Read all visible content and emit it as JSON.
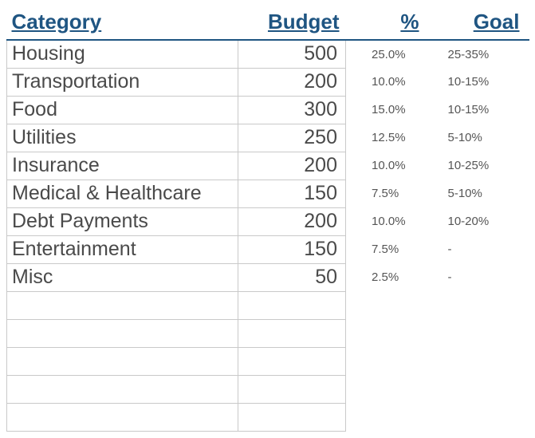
{
  "headers": {
    "category": "Category",
    "budget": "Budget",
    "percent": "%",
    "goal": "Goal"
  },
  "rows": [
    {
      "category": "Housing",
      "budget": "500",
      "percent": "25.0%",
      "goal": "25-35%"
    },
    {
      "category": "Transportation",
      "budget": "200",
      "percent": "10.0%",
      "goal": "10-15%"
    },
    {
      "category": "Food",
      "budget": "300",
      "percent": "15.0%",
      "goal": "10-15%"
    },
    {
      "category": "Utilities",
      "budget": "250",
      "percent": "12.5%",
      "goal": "5-10%"
    },
    {
      "category": "Insurance",
      "budget": "200",
      "percent": "10.0%",
      "goal": "10-25%"
    },
    {
      "category": "Medical & Healthcare",
      "budget": "150",
      "percent": "7.5%",
      "goal": "5-10%"
    },
    {
      "category": "Debt Payments",
      "budget": "200",
      "percent": "10.0%",
      "goal": "10-20%"
    },
    {
      "category": "Entertainment",
      "budget": "150",
      "percent": "7.5%",
      "goal": "-"
    },
    {
      "category": "Misc",
      "budget": "50",
      "percent": "2.5%",
      "goal": "-"
    },
    {
      "category": "",
      "budget": "",
      "percent": "",
      "goal": ""
    },
    {
      "category": "",
      "budget": "",
      "percent": "",
      "goal": ""
    },
    {
      "category": "",
      "budget": "",
      "percent": "",
      "goal": ""
    },
    {
      "category": "",
      "budget": "",
      "percent": "",
      "goal": ""
    },
    {
      "category": "",
      "budget": "",
      "percent": "",
      "goal": ""
    }
  ],
  "chart_data": {
    "type": "table",
    "title": "Budget Categories",
    "columns": [
      "Category",
      "Budget",
      "%",
      "Goal"
    ],
    "rows": [
      [
        "Housing",
        500,
        25.0,
        "25-35%"
      ],
      [
        "Transportation",
        200,
        10.0,
        "10-15%"
      ],
      [
        "Food",
        300,
        15.0,
        "10-15%"
      ],
      [
        "Utilities",
        250,
        12.5,
        "5-10%"
      ],
      [
        "Insurance",
        200,
        10.0,
        "10-25%"
      ],
      [
        "Medical & Healthcare",
        150,
        7.5,
        "5-10%"
      ],
      [
        "Debt Payments",
        200,
        10.0,
        "10-20%"
      ],
      [
        "Entertainment",
        150,
        7.5,
        null
      ],
      [
        "Misc",
        50,
        2.5,
        null
      ]
    ]
  }
}
